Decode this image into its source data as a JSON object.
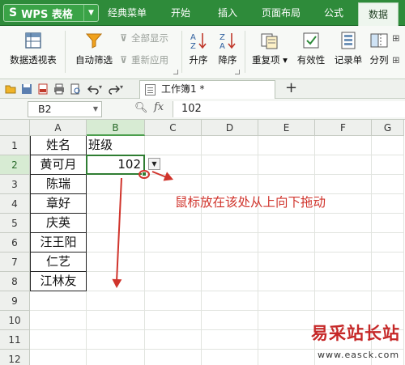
{
  "app": {
    "title": "WPS 表格",
    "logo": "S"
  },
  "menu_tabs": [
    {
      "label": "经典菜单",
      "active": false
    },
    {
      "label": "开始",
      "active": false
    },
    {
      "label": "插入",
      "active": false
    },
    {
      "label": "页面布局",
      "active": false
    },
    {
      "label": "公式",
      "active": false
    },
    {
      "label": "数据",
      "active": true
    }
  ],
  "ribbon": {
    "pivot_table": "数据透视表",
    "auto_filter": "自动筛选",
    "show_all": "全部显示",
    "reapply": "重新应用",
    "sort_asc": "升序",
    "sort_desc": "降序",
    "duplicates": "重复项",
    "validity": "有效性",
    "record_form": "记录单",
    "split": "分列"
  },
  "document": {
    "tab_title": "工作簿1 *",
    "new_tab": "+"
  },
  "formula_bar": {
    "cell_ref": "B2",
    "fx": "fx",
    "value": "102"
  },
  "columns": [
    "A",
    "B",
    "C",
    "D",
    "E",
    "F",
    "G"
  ],
  "rows": [
    "1",
    "2",
    "3",
    "4",
    "5",
    "6",
    "7",
    "8",
    "9",
    "10",
    "11",
    "12",
    "13"
  ],
  "cells": {
    "A1": "姓名",
    "B1": "班级",
    "A2": "黄可月",
    "B2": "102",
    "A3": "陈瑞",
    "A4": "章好",
    "A5": "庆英",
    "A6": "汪王阳",
    "A7": "仁艺",
    "A8": "江林友"
  },
  "annotation": {
    "text": "鼠标放在该处从上向下拖动",
    "color": "#d0342c"
  },
  "watermark": {
    "title": "易采站长站",
    "url": "www.easck.com"
  },
  "colors": {
    "menu_bg": "#2e8b3a",
    "selection": "#2f7d32",
    "annotation": "#d0342c"
  }
}
